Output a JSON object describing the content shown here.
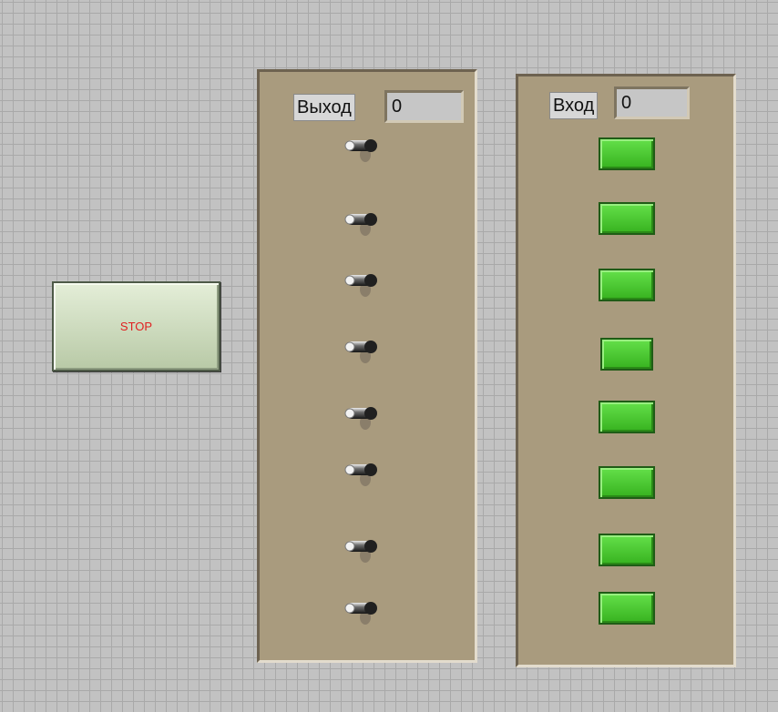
{
  "front_panel": {
    "stop_button": {
      "label": "STOP"
    },
    "output_panel": {
      "label": "Выход",
      "numeric_value": "0",
      "switch_count": 8
    },
    "input_panel": {
      "label": "Вход",
      "numeric_value": "0",
      "led_count": 8
    }
  },
  "colors": {
    "grid_background": "#c2c2c2",
    "panel": "#a99b7e",
    "stop_text": "#e02020",
    "led_on": "#4cc82f"
  },
  "icons": {
    "switch": "toggle-switch-icon",
    "led": "led-indicator"
  }
}
